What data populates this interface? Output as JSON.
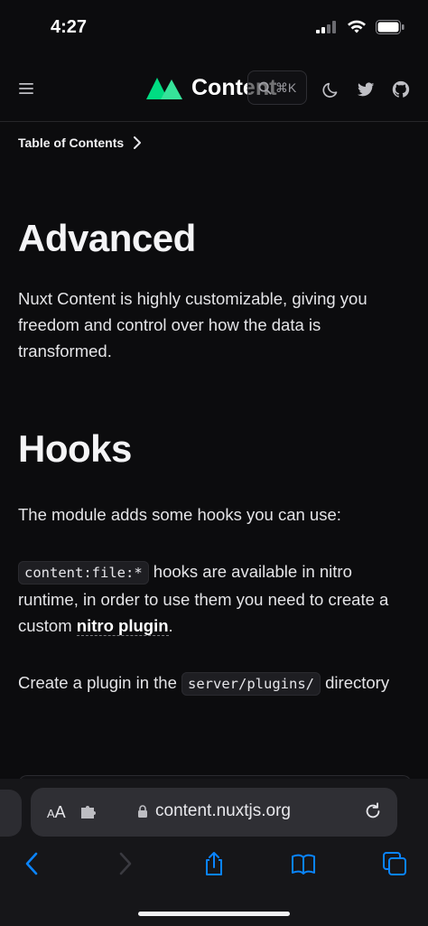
{
  "status": {
    "time": "4:27"
  },
  "nav": {
    "brand": "Content",
    "search_shortcut": "⌘K"
  },
  "toc": {
    "label": "Table of Contents"
  },
  "article": {
    "h1": "Advanced",
    "intro": "Nuxt Content is highly customizable, giving you freedom and control over how the data is transformed.",
    "h2": "Hooks",
    "p1": "The module adds some hooks you can use:",
    "p2_code": "content:file:*",
    "p2_text1": " hooks are available in nitro runtime, in order to use them you need to create a custom ",
    "p2_link": "nitro plugin",
    "p2_end": ".",
    "p3_text1": "Create a plugin in the ",
    "p3_code": "server/plugins/",
    "p3_text2": " directory"
  },
  "browser": {
    "aa_label_small": "A",
    "aa_label": "A",
    "url": "content.nuxtjs.org"
  },
  "colors": {
    "brand_green": "#00DC82",
    "link_blue": "#0a84ff"
  }
}
